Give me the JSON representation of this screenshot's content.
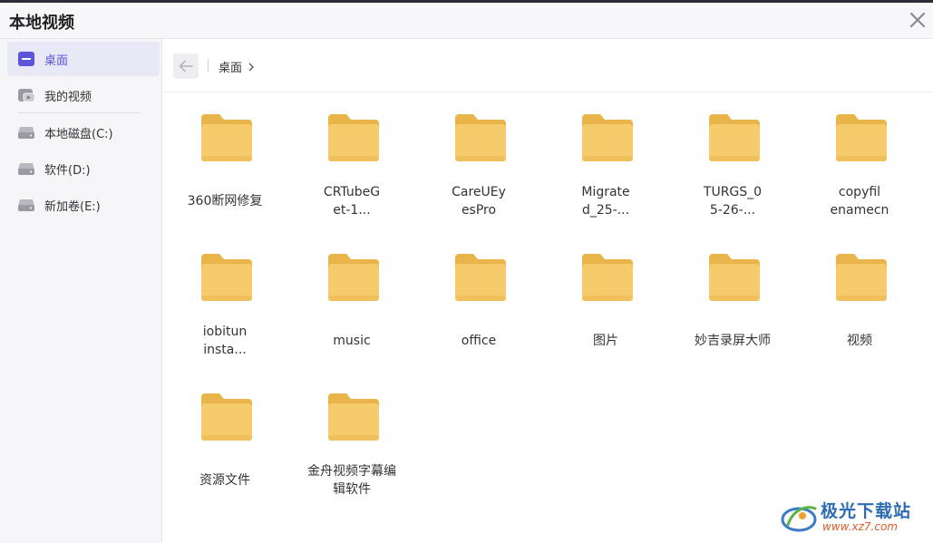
{
  "window": {
    "title": "本地视频"
  },
  "sidebar": {
    "items": [
      {
        "label": "桌面",
        "icon": "desktop-icon",
        "active": true
      },
      {
        "label": "我的视频",
        "icon": "video-drive-icon",
        "active": false
      },
      {
        "label": "本地磁盘(C:)",
        "icon": "drive-icon",
        "active": false
      },
      {
        "label": "软件(D:)",
        "icon": "drive-icon",
        "active": false
      },
      {
        "label": "新加卷(E:)",
        "icon": "drive-icon",
        "active": false
      }
    ]
  },
  "nav": {
    "breadcrumb": "桌面"
  },
  "folders": [
    {
      "name": "360断网修复"
    },
    {
      "name": "CRTubeGet-1..."
    },
    {
      "name": "CareUEyesPro"
    },
    {
      "name": "Migrated_25-..."
    },
    {
      "name": "TURGS_05-26-..."
    },
    {
      "name": "copyfilenamecn"
    },
    {
      "name": "iobituninsta..."
    },
    {
      "name": "music"
    },
    {
      "name": "office"
    },
    {
      "name": "图片"
    },
    {
      "name": "妙吉录屏大师"
    },
    {
      "name": "视频"
    },
    {
      "name": "资源文件"
    },
    {
      "name": "金舟视频字幕编辑软件"
    }
  ],
  "folder_labels": [
    [
      "360断网修复"
    ],
    [
      "CRTubeG",
      "et-1..."
    ],
    [
      "CareUEy",
      "esPro"
    ],
    [
      "Migrate",
      "d_25-..."
    ],
    [
      "TURGS_0",
      "5-26-..."
    ],
    [
      "copyfil",
      "enamecn"
    ],
    [
      "iobitun",
      "insta..."
    ],
    [
      "music"
    ],
    [
      "office"
    ],
    [
      "图片"
    ],
    [
      "妙吉录屏大师"
    ],
    [
      "视频"
    ],
    [
      "资源文件"
    ],
    [
      "金舟视频字幕编",
      "辑软件"
    ]
  ],
  "watermark": {
    "name": "极光下载站",
    "url": "www.xz7.com"
  },
  "colors": {
    "accent": "#5b56d9",
    "folder": "#f6cb6b",
    "folder_back": "#e9b54a",
    "active_bg": "#e8e8f6"
  }
}
